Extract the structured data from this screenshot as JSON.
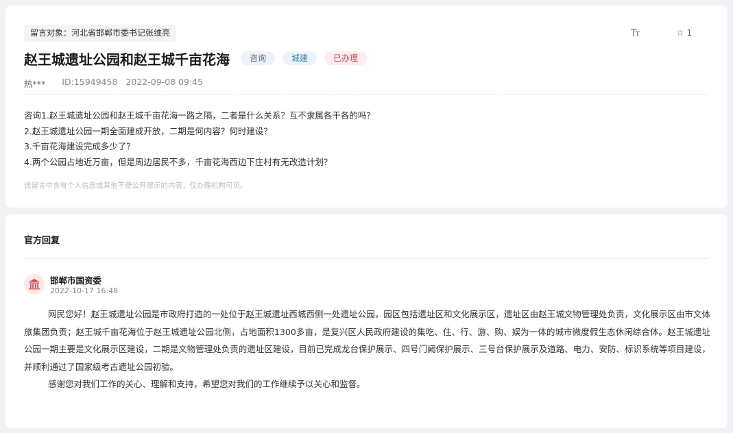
{
  "message": {
    "target_chip": "留言对象：河北省邯郸市委书记张维亮",
    "font_tool": {
      "large": "T",
      "small": "T"
    },
    "favorite": {
      "icon": "star-icon",
      "count": "1"
    },
    "title": "赵王城遗址公园和赵王城千亩花海",
    "tags": [
      "咨询",
      "城建",
      "已办理"
    ],
    "author": "热***",
    "id_text": "ID:15949458",
    "datetime": "2022-09-08 09:45",
    "content": [
      "咨询1.赵王城遗址公园和赵王城千亩花海一路之隔，二者是什么关系？互不隶属各干各的吗？",
      "2.赵王城遗址公园一期全面建成开放，二期是何内容？何时建设？",
      "3.千亩花海建设完成多少了？",
      "4.两个公园占地近万亩，但是周边居民不多，千亩花海西边下庄村有无改造计划？"
    ],
    "notice": "该留言中含有个人信息或其他不便公开展示的内容，仅办理机构可见。"
  },
  "reply": {
    "section_title": "官方回复",
    "org_name": "邯郸市国资委",
    "org_time": "2022-10-17 16:48",
    "paragraphs": [
      "网民您好！赵王城遗址公园是市政府打造的一处位于赵王城遗址西城西侧一处遗址公园，园区包括遗址区和文化展示区，遗址区由赵王城文物管理处负责，文化展示区由市文体旅集团负责；赵王城千亩花海位于赵王城遗址公园北侧，占地面积1300多亩，是复兴区人民政府建设的集吃、住、行、游、购、娱为一体的城市微度假生态休闲综合体。赵王城遗址公园一期主要是文化展示区建设，二期是文物管理处负责的遗址区建设，目前已完成龙台保护展示、四号门阙保护展示、三号台保护展示及道路、电力、安防、标识系统等项目建设，并顺利通过了国家级考古遗址公园初验。",
      "感谢您对我们工作的关心、理解和支持，希望您对我们的工作继续予以关心和监督。"
    ]
  },
  "colors": {
    "page_bg": "#f0f2f5",
    "tag_consult": "#5a6b85",
    "tag_city": "#3f7fb0",
    "tag_done": "#d9474f",
    "org_icon": "#d9474f"
  }
}
